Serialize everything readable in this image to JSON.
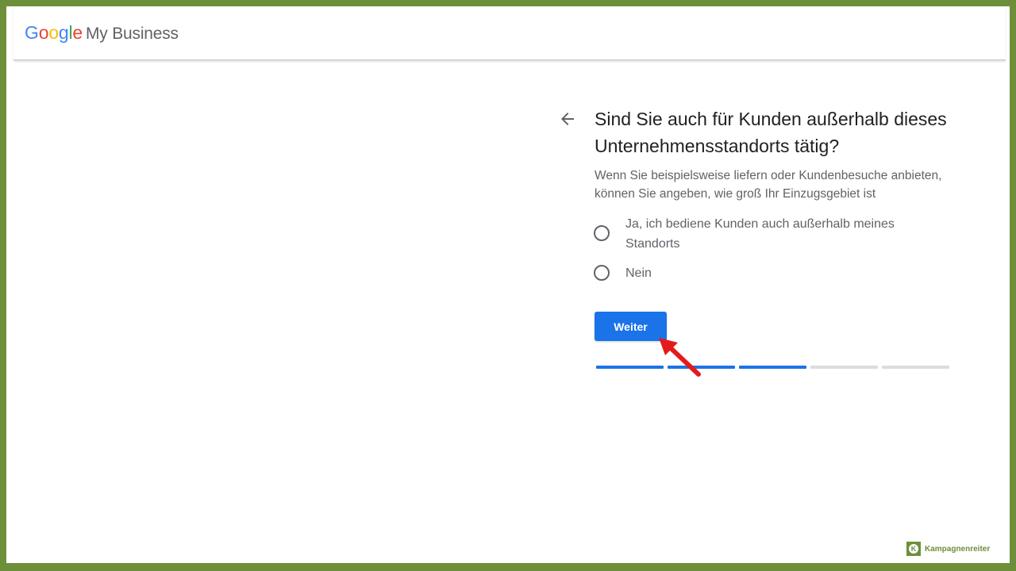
{
  "header": {
    "logo_google": [
      "G",
      "o",
      "o",
      "g",
      "l",
      "e"
    ],
    "logo_colors": [
      "#4285F4",
      "#EA4335",
      "#FBBC05",
      "#4285F4",
      "#34A853",
      "#EA4335"
    ],
    "product_name": "My Business"
  },
  "main": {
    "title": "Sind Sie auch für Kunden außerhalb dieses Unternehmensstandorts tätig?",
    "subtitle": "Wenn Sie beispielsweise liefern oder Kundenbesuche anbieten, können Sie angeben, wie groß Ihr Einzugsgebiet ist",
    "options": [
      {
        "label": "Ja, ich bediene Kunden auch außerhalb meines Standorts",
        "selected": false
      },
      {
        "label": "Nein",
        "selected": false
      }
    ],
    "next_button_label": "Weiter",
    "progress": {
      "completed_steps": 3,
      "total_steps": 5
    }
  },
  "watermark": {
    "text": "Kampagnenreiter",
    "logo_letter": "K"
  },
  "colors": {
    "accent": "#1a73e8",
    "progress_inactive": "#dadce0",
    "annotation_arrow": "#e31b1b",
    "frame_border": "#6e8f3a"
  }
}
